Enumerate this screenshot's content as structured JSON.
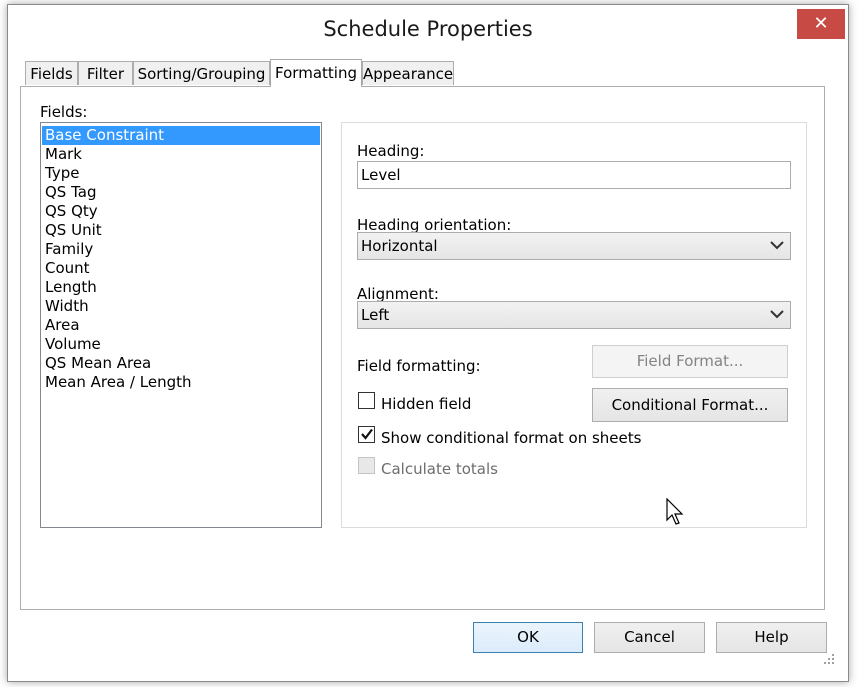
{
  "window": {
    "title": "Schedule Properties",
    "close_glyph": "✕"
  },
  "tabs": [
    {
      "label": "Fields",
      "active": false
    },
    {
      "label": "Filter",
      "active": false
    },
    {
      "label": "Sorting/Grouping",
      "active": false
    },
    {
      "label": "Formatting",
      "active": true
    },
    {
      "label": "Appearance",
      "active": false
    }
  ],
  "fields": {
    "label": "Fields:",
    "items": [
      "Base Constraint",
      "Mark",
      "Type",
      "QS Tag",
      "QS Qty",
      "QS Unit",
      "Family",
      "Count",
      "Length",
      "Width",
      "Area",
      "Volume",
      "QS Mean Area",
      "Mean Area / Length"
    ],
    "selected": "Base Constraint"
  },
  "formatting": {
    "heading_label": "Heading:",
    "heading_value": "Level",
    "orientation_label": "Heading orientation:",
    "orientation_value": "Horizontal",
    "alignment_label": "Alignment:",
    "alignment_value": "Left",
    "field_formatting_label": "Field formatting:",
    "field_format_button": "Field Format...",
    "conditional_format_button": "Conditional  Format...",
    "hidden_field_label": "Hidden field",
    "hidden_field_checked": false,
    "show_conditional_label": "Show conditional format on sheets",
    "show_conditional_checked": true,
    "calculate_totals_label": "Calculate totals",
    "calculate_totals_checked": false
  },
  "footer": {
    "ok": "OK",
    "cancel": "Cancel",
    "help": "Help"
  }
}
